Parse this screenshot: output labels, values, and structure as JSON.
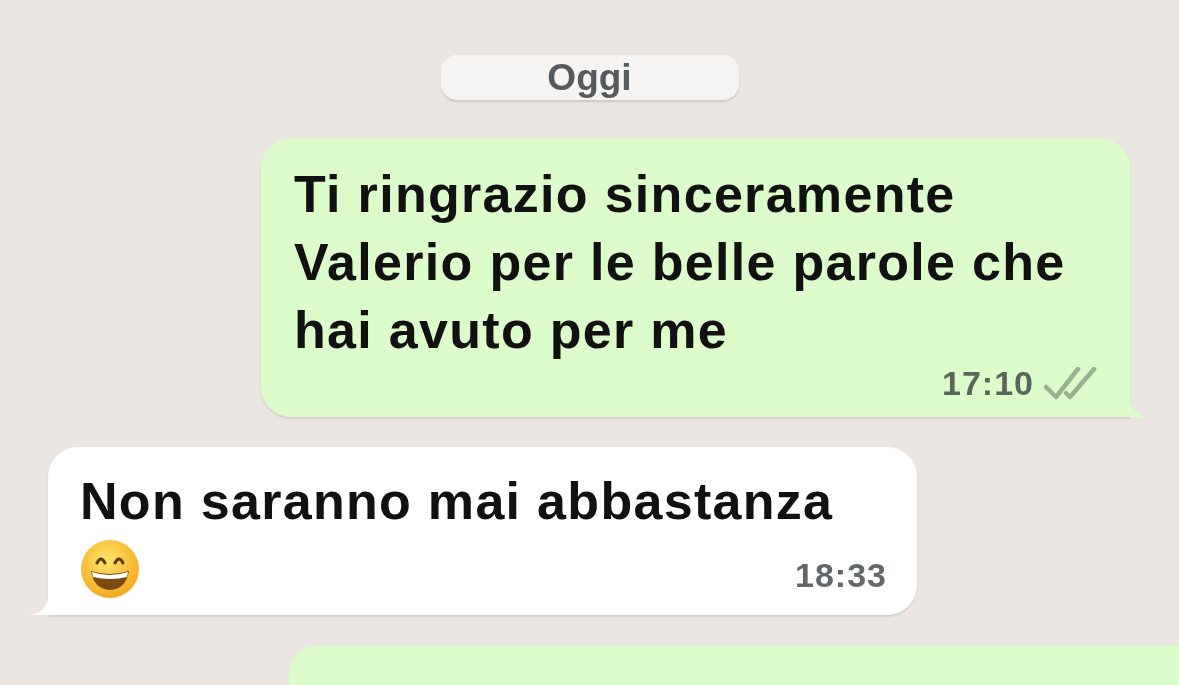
{
  "date_chip": "Oggi",
  "messages": [
    {
      "kind": "outgoing",
      "text": "Ti ringrazio sinceramente Valerio per le belle parole che hai avuto per me",
      "time": "17:10",
      "read": false,
      "has_emoji": false
    },
    {
      "kind": "incoming",
      "text": "Non saranno mai abbastanza",
      "time": "18:33",
      "has_emoji": true
    },
    {
      "kind": "outgoing",
      "partial": true
    }
  ]
}
